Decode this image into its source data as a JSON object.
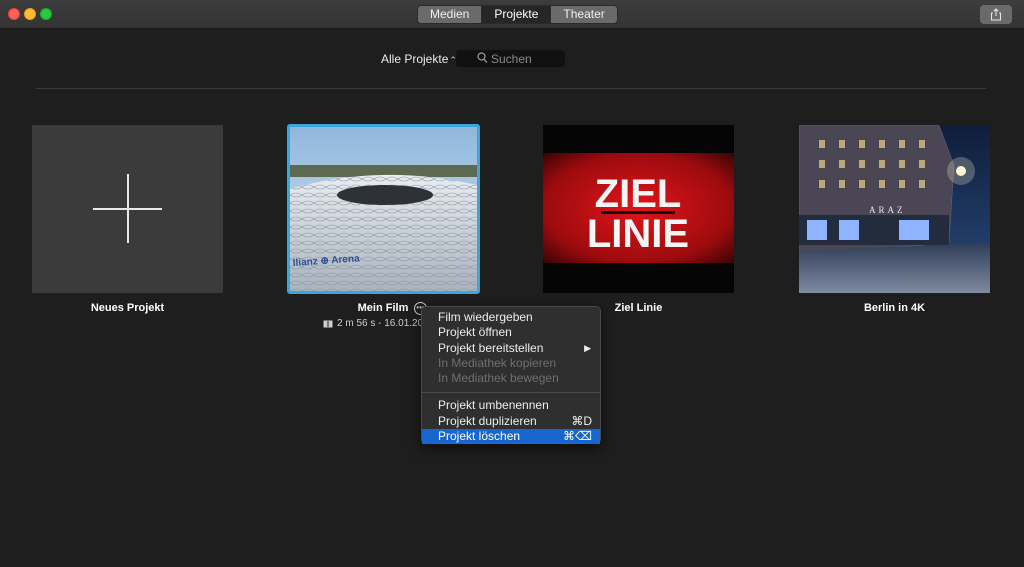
{
  "toolbar": {
    "tabs": [
      {
        "label": "Medien",
        "active": false
      },
      {
        "label": "Projekte",
        "active": true
      },
      {
        "label": "Theater",
        "active": false
      }
    ],
    "share_icon": "share-icon"
  },
  "filter": {
    "label": "Alle Projekte",
    "search_placeholder": "Suchen"
  },
  "projects": [
    {
      "title": "Neues Projekt",
      "thumbnail": "plus-icon"
    },
    {
      "title": "Mein Film",
      "meta": "2 m 56 s - 16.01.20",
      "selected": true,
      "thumbnail_text": "llianz ⊕ Arena"
    },
    {
      "title": "Ziel Linie",
      "thumbnail_text": [
        "ZIEL",
        "LINIE"
      ]
    },
    {
      "title": "Berlin in 4K",
      "thumbnail_text": "ARAZ"
    }
  ],
  "context_menu": {
    "items": [
      {
        "label": "Film wiedergeben",
        "enabled": true
      },
      {
        "label": "Projekt öffnen",
        "enabled": true
      },
      {
        "label": "Projekt bereitstellen",
        "enabled": true,
        "submenu": true
      },
      {
        "label": "In Mediathek kopieren",
        "enabled": false
      },
      {
        "label": "In Mediathek bewegen",
        "enabled": false
      },
      {
        "label": "Projekt umbenennen",
        "enabled": true
      },
      {
        "label": "Projekt duplizieren",
        "enabled": true,
        "shortcut": "⌘D"
      },
      {
        "label": "Projekt löschen",
        "enabled": true,
        "shortcut": "⌘⌫",
        "highlighted": true
      }
    ]
  },
  "colors": {
    "selection_border": "#39a6dc",
    "menu_highlight": "#1866cf",
    "background": "#1e1e1e"
  }
}
